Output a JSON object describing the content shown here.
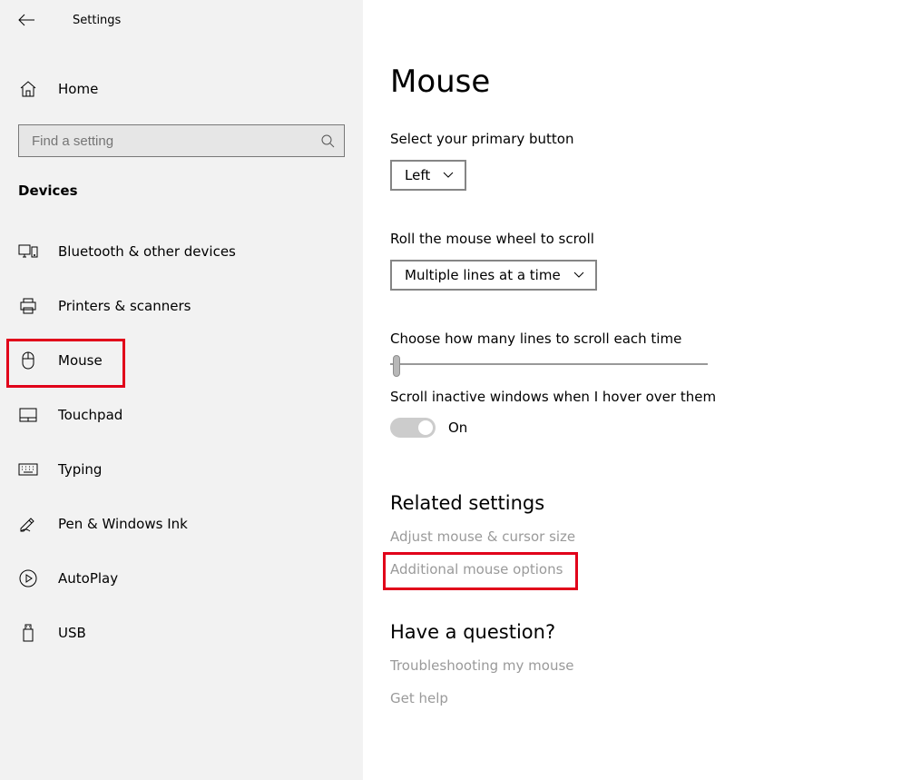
{
  "app_title": "Settings",
  "home_label": "Home",
  "search_placeholder": "Find a setting",
  "section_label": "Devices",
  "nav": [
    {
      "label": "Bluetooth & other devices"
    },
    {
      "label": "Printers & scanners"
    },
    {
      "label": "Mouse"
    },
    {
      "label": "Touchpad"
    },
    {
      "label": "Typing"
    },
    {
      "label": "Pen & Windows Ink"
    },
    {
      "label": "AutoPlay"
    },
    {
      "label": "USB"
    }
  ],
  "page_title": "Mouse",
  "primary_button": {
    "label": "Select your primary button",
    "value": "Left"
  },
  "scroll_wheel": {
    "label": "Roll the mouse wheel to scroll",
    "value": "Multiple lines at a time"
  },
  "lines_label": "Choose how many lines to scroll each time",
  "inactive": {
    "label": "Scroll inactive windows when I hover over them",
    "value": "On"
  },
  "related": {
    "heading": "Related settings",
    "links": [
      "Adjust mouse & cursor size",
      "Additional mouse options"
    ]
  },
  "question": {
    "heading": "Have a question?",
    "links": [
      "Troubleshooting my mouse",
      "Get help"
    ]
  }
}
